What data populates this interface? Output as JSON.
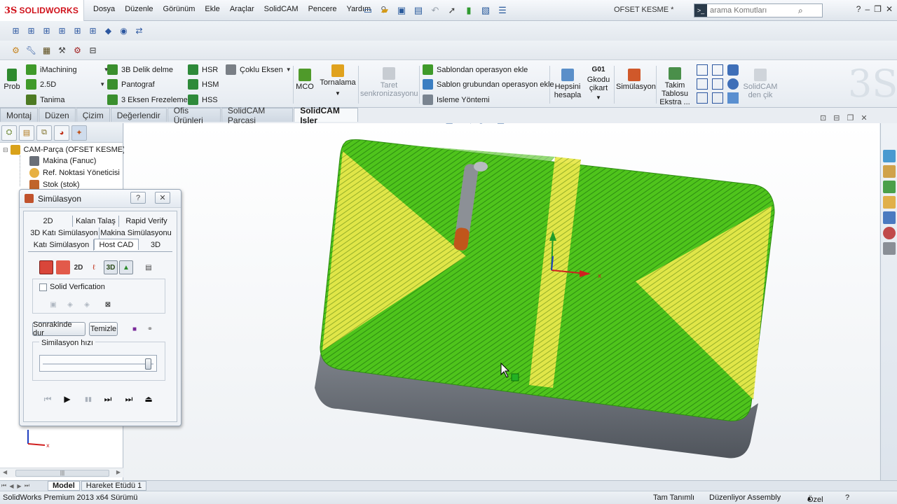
{
  "app": {
    "brand": "SOLIDWORKS",
    "document_title": "OFSET KESME *"
  },
  "menu": [
    "Dosya",
    "Düzenle",
    "Görünüm",
    "Ekle",
    "Araçlar",
    "SolidCAM",
    "Pencere",
    "Yardım"
  ],
  "search": {
    "placeholder": "arama Komutları"
  },
  "ribbon": {
    "prob": "Prob",
    "imachining": "iMachining",
    "d25": "2.5D",
    "tanima": "Tanima",
    "delik": "3B Delik delme",
    "pantograf": "Pantograf",
    "eksen3": "3 Eksen Frezeleme",
    "hsr": "HSR",
    "hsm": "HSM",
    "hss": "HSS",
    "coklu": "Çoklu Eksen",
    "mco": "MCO",
    "tornalama": "Tornalama",
    "taret": "Taret senkronizasyonu",
    "sablondan": "Sablondan operasyon ekle",
    "sablon_grup": "Sablon grubundan operasyon ekle",
    "isleme": "Isleme Yöntemi",
    "hepsini": "Hepsini hesapla",
    "gkodu_top": "G01",
    "gkodu": "Gkodu çikart",
    "simulasyon": "Simülasyon",
    "takim": "Takim Tablosu Ekstra ...",
    "solidcam_cik": "SolidCAM den çik"
  },
  "cm_tabs": [
    "Montaj",
    "Düzen",
    "Çizim",
    "Değerlendir",
    "Ofis Ürünleri",
    "SolidCAM Parçasi",
    "SolidCAM Isler"
  ],
  "tree": {
    "root": "CAM-Parça (OFSET KESME)",
    "items": [
      "Makina (Fanuc)",
      "Ref. Noktasi Yöneticisi",
      "Stok (stok)"
    ]
  },
  "sim_dialog": {
    "title": "Simülasyon",
    "help": "?",
    "tabs_row1": [
      "2D",
      "Kalan Talaş",
      "Rapid Verify"
    ],
    "tabs_row2": [
      "3D Katı Simülasyon",
      "Makina Simülasyonu"
    ],
    "tabs_row3": [
      "Katı Simülasyon",
      "Host CAD",
      "3D"
    ],
    "solid_verification": "Solid Verfication",
    "btn_stop": "Sonrakinde dur",
    "btn_clear": "Temizle",
    "speed_label": "Similasyon hızı"
  },
  "bottom_tabs": [
    "Model",
    "Hareket Etüdü 1"
  ],
  "status": {
    "version": "SolidWorks Premium 2013 x64 Sürümü",
    "tam": "Tam Tanımlı",
    "duzen": "Düzenliyor Assembly",
    "ozel": "Özel"
  },
  "colors": {
    "toolpath_green": "#4fc41c",
    "toolpath_yellow": "#e8e84a",
    "part_grey": "#6a6f77",
    "tool_orange": "#c0561b",
    "brand_red": "#d0121b"
  }
}
